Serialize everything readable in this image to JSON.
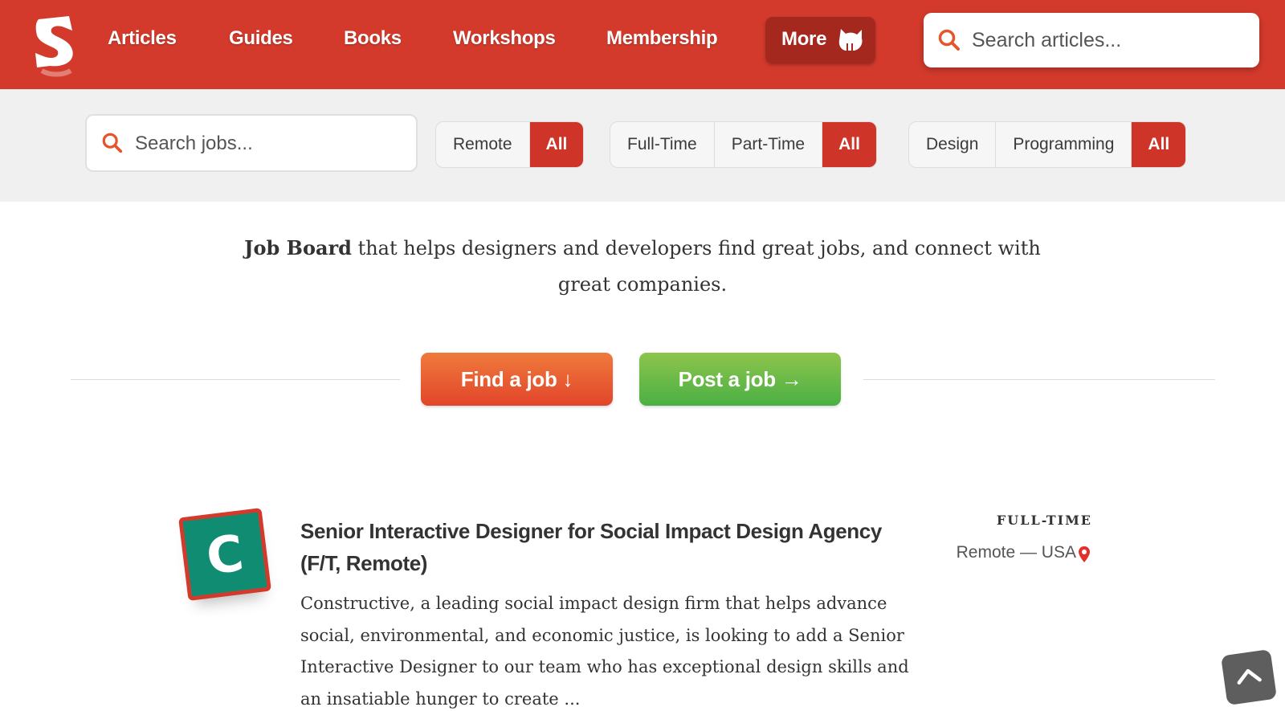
{
  "nav": {
    "items": [
      "Articles",
      "Guides",
      "Books",
      "Workshops",
      "Membership"
    ],
    "more_label": "More",
    "search_placeholder": "Search articles..."
  },
  "filters": {
    "search_placeholder": "Search jobs...",
    "location": [
      "Remote",
      "All"
    ],
    "type": [
      "Full-Time",
      "Part-Time",
      "All"
    ],
    "category": [
      "Design",
      "Programming",
      "All"
    ]
  },
  "intro": {
    "bold": "Job Board",
    "text": " that helps designers and developers find great jobs, and connect with great companies."
  },
  "buttons": {
    "find": "Find a job ↓",
    "post": "Post a job →"
  },
  "job": {
    "logo_letter": "C",
    "title": "Senior Interactive Designer for Social Impact Design Agency (F/T, Remote)",
    "description": "Constructive, a leading social impact design firm that helps advance social, environmental, and economic justice, is looking to add a Senior Interactive Designer to our team who has exceptional design skills and an insatiable hunger to create ...",
    "type": "FULL-TIME",
    "location": "Remote — USA"
  },
  "colors": {
    "brand_red": "#d33a2c",
    "active_filter": "#cf3428",
    "find_button": "#e2452a",
    "post_button": "#4ab044",
    "company_logo": "#108c73"
  }
}
